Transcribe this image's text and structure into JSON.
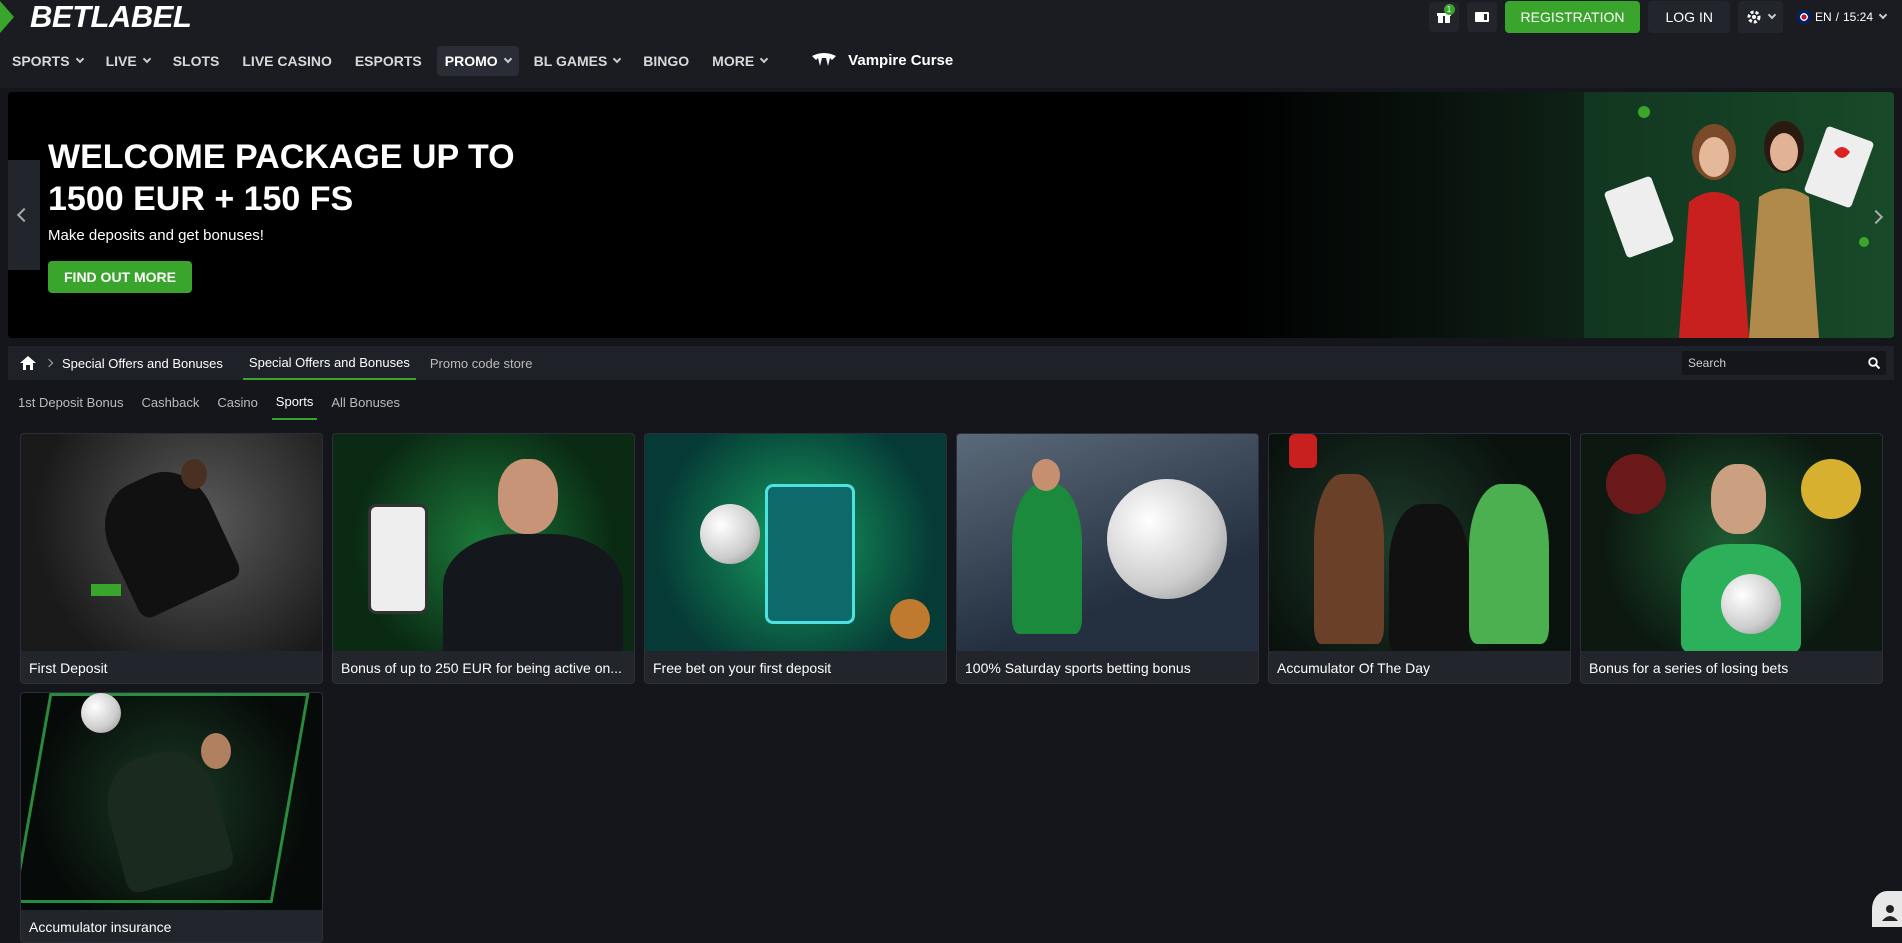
{
  "header": {
    "logo": "BETLABEL",
    "gift_count": "1",
    "register_label": "REGISTRATION",
    "login_label": "LOG IN",
    "language": "EN",
    "time": "15:24",
    "accent": "#3aa52c"
  },
  "nav": {
    "items": [
      {
        "label": "SPORTS"
      },
      {
        "label": "LIVE"
      },
      {
        "label": "SLOTS"
      },
      {
        "label": "LIVE CASINO"
      },
      {
        "label": "ESPORTS"
      },
      {
        "label": "PROMO"
      },
      {
        "label": "BL GAMES"
      },
      {
        "label": "BINGO"
      },
      {
        "label": "MORE"
      }
    ],
    "featured_game": "Vampire Curse"
  },
  "banner": {
    "title": "WELCOME PACKAGE UP TO 1500 EUR + 150 FS",
    "subtitle": "Make deposits and get bonuses!",
    "cta": "FIND OUT MORE"
  },
  "breadcrumb": {
    "current": "Special Offers and Bonuses"
  },
  "top_tabs": [
    {
      "label": "Special Offers and Bonuses"
    },
    {
      "label": "Promo code store"
    }
  ],
  "search": {
    "placeholder": "Search"
  },
  "sub_tabs": [
    {
      "label": "1st Deposit Bonus"
    },
    {
      "label": "Cashback"
    },
    {
      "label": "Casino"
    },
    {
      "label": "Sports"
    },
    {
      "label": "All Bonuses"
    }
  ],
  "cards": [
    {
      "title": "First Deposit"
    },
    {
      "title": "Bonus of up to 250 EUR for being active on..."
    },
    {
      "title": "Free bet on your first deposit"
    },
    {
      "title": "100% Saturday sports betting bonus"
    },
    {
      "title": "Accumulator Of The Day"
    },
    {
      "title": "Bonus for a series of losing bets"
    },
    {
      "title": "Accumulator insurance"
    }
  ]
}
